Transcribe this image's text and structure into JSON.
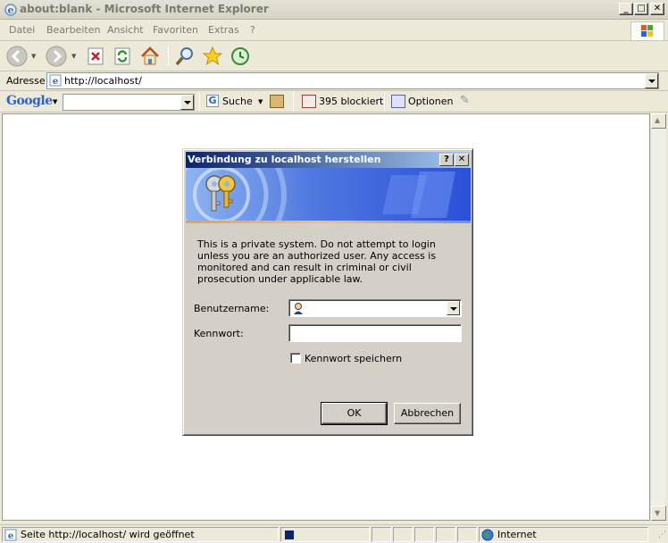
{
  "window": {
    "title": "about:blank - Microsoft Internet Explorer"
  },
  "menu": {
    "items": [
      "Datei",
      "Bearbeiten",
      "Ansicht",
      "Favoriten",
      "Extras",
      "?"
    ]
  },
  "toolbar": {
    "icons": [
      "back-icon",
      "forward-icon",
      "stop-icon",
      "refresh-icon",
      "home-icon",
      "search-icon",
      "favorites-icon",
      "history-icon"
    ]
  },
  "address": {
    "label": "Adresse",
    "url": "http://localhost/"
  },
  "google_bar": {
    "logo": "Google",
    "search_label": "Suche",
    "blocked_label": "395 blockiert",
    "options_label": "Optionen"
  },
  "dialog": {
    "title": "Verbindung zu localhost herstellen",
    "help_button": "?",
    "close_button": "✕",
    "message": "This is a private system. Do not attempt to login unless you are an authorized user. Any access is monitored and can result in criminal or civil prosecution under applicable law.",
    "username_label": "Benutzername:",
    "username_value": "",
    "password_label": "Kennwort:",
    "password_value": "",
    "remember_label": "Kennwort speichern",
    "remember_checked": false,
    "ok_label": "OK",
    "cancel_label": "Abbrechen"
  },
  "status": {
    "text": "Seite http://localhost/ wird geöffnet",
    "zone": "Internet"
  },
  "colors": {
    "dialog_title_start": "#0a246a",
    "dialog_title_end": "#a6caf0",
    "banner_blue": "#2b4fd8"
  }
}
